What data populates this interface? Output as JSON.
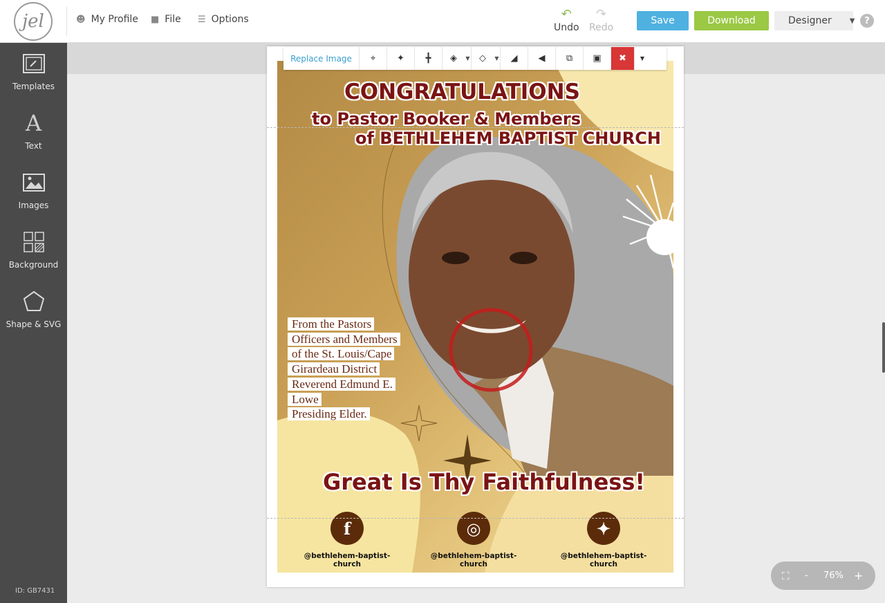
{
  "header": {
    "logo_text": "jel",
    "menu": {
      "profile": "My Profile",
      "file": "File",
      "options": "Options"
    },
    "undo": "Undo",
    "redo": "Redo",
    "save": "Save",
    "download": "Download",
    "designer": "Designer",
    "help": "?"
  },
  "sidebar": {
    "items": [
      {
        "label": "Templates",
        "icon": "templates-icon"
      },
      {
        "label": "Text",
        "icon": "text-icon"
      },
      {
        "label": "Images",
        "icon": "images-icon"
      },
      {
        "label": "Background",
        "icon": "background-icon"
      },
      {
        "label": "Shape & SVG",
        "icon": "shape-icon"
      }
    ],
    "id_label": "ID: GB7431"
  },
  "toolbar": {
    "replace_image": "Replace Image"
  },
  "design": {
    "title": "CONGRATULATIONS",
    "line2": "to Pastor Booker & Members",
    "line3": "of BETHLEHEM BAPTIST CHURCH",
    "body_lines": [
      "From the Pastors",
      "Officers and Members",
      "of the St. Louis/Cape",
      "Girardeau District",
      "Reverend Edmund E.",
      "Lowe",
      "Presiding Elder."
    ],
    "tagline": "Great Is Thy Faithfulness!",
    "socials": [
      {
        "icon": "facebook-icon",
        "glyph": "f",
        "handle": "@bethlehem-baptist-church"
      },
      {
        "icon": "instagram-icon",
        "glyph": "◎",
        "handle": "@bethlehem-baptist-church"
      },
      {
        "icon": "twitter-icon",
        "glyph": "✦",
        "handle": "@bethlehem-baptist-church"
      }
    ],
    "colors": {
      "title": "#7a1414",
      "gold": "#c99f55",
      "brown": "#5c2c0a"
    }
  },
  "zoom": {
    "minus": "-",
    "value": "76%",
    "plus": "+"
  }
}
